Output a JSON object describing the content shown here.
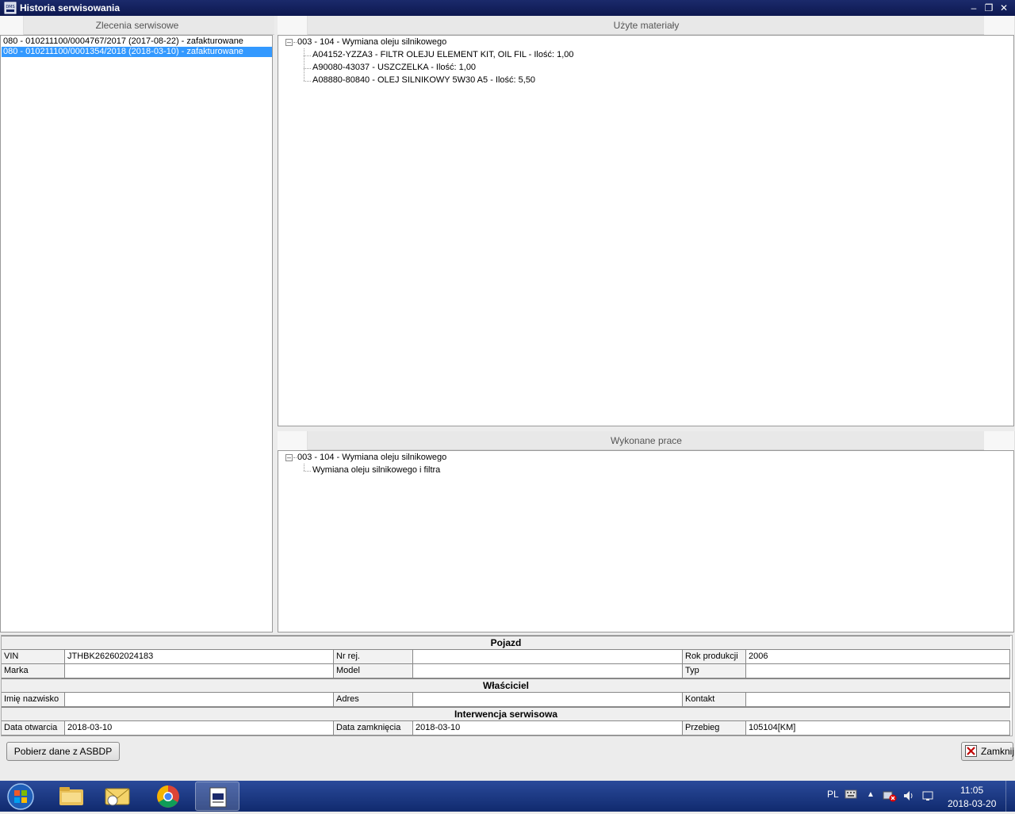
{
  "window": {
    "title": "Historia serwisowania",
    "app_icon_text": "DMS"
  },
  "orders": {
    "header": "Zlecenia serwisowe",
    "items": [
      {
        "label": "080 - 010211100/0004767/2017 (2017-08-22) - zafakturowane",
        "selected": false
      },
      {
        "label": "080 - 010211100/0001354/2018 (2018-03-10) - zafakturowane",
        "selected": true
      }
    ]
  },
  "materials": {
    "header": "Użyte materiały",
    "root": "003 - 104 - Wymiana oleju silnikowego",
    "children": [
      "A04152-YZZA3 - FILTR OLEJU ELEMENT KIT, OIL FIL - Ilość: 1,00",
      "A90080-43037 - USZCZELKA - Ilość: 1,00",
      "A08880-80840 - OLEJ SILNIKOWY 5W30 A5 - Ilość: 5,50"
    ]
  },
  "works": {
    "header": "Wykonane prace",
    "root": "003 - 104 - Wymiana oleju silnikowego",
    "children": [
      "Wymiana oleju silnikowego i filtra"
    ]
  },
  "vehicle": {
    "section": "Pojazd",
    "vin_label": "VIN",
    "vin_value": "JTHBK262602024183",
    "reg_label": "Nr rej.",
    "reg_value": "",
    "year_label": "Rok produkcji",
    "year_value": "2006",
    "make_label": "Marka",
    "make_value": "",
    "model_label": "Model",
    "model_value": "",
    "type_label": "Typ",
    "type_value": ""
  },
  "owner": {
    "section": "Właściciel",
    "name_label": "Imię nazwisko",
    "name_value": "",
    "address_label": "Adres",
    "address_value": "",
    "contact_label": "Kontakt",
    "contact_value": ""
  },
  "intervention": {
    "section": "Interwencja serwisowa",
    "open_label": "Data otwarcia",
    "open_value": "2018-03-10",
    "close_label": "Data zamknięcia",
    "close_value": "2018-03-10",
    "mileage_label": "Przebieg",
    "mileage_value": "105104[KM]"
  },
  "buttons": {
    "fetch": "Pobierz dane z ASBDP",
    "close": "Zamknij"
  },
  "taskbar": {
    "language": "PL",
    "time": "11:05",
    "date": "2018-03-20"
  },
  "colors": {
    "titlebar": "#0d1850",
    "selection": "#3399ff",
    "taskbar": "#1a3a86"
  }
}
